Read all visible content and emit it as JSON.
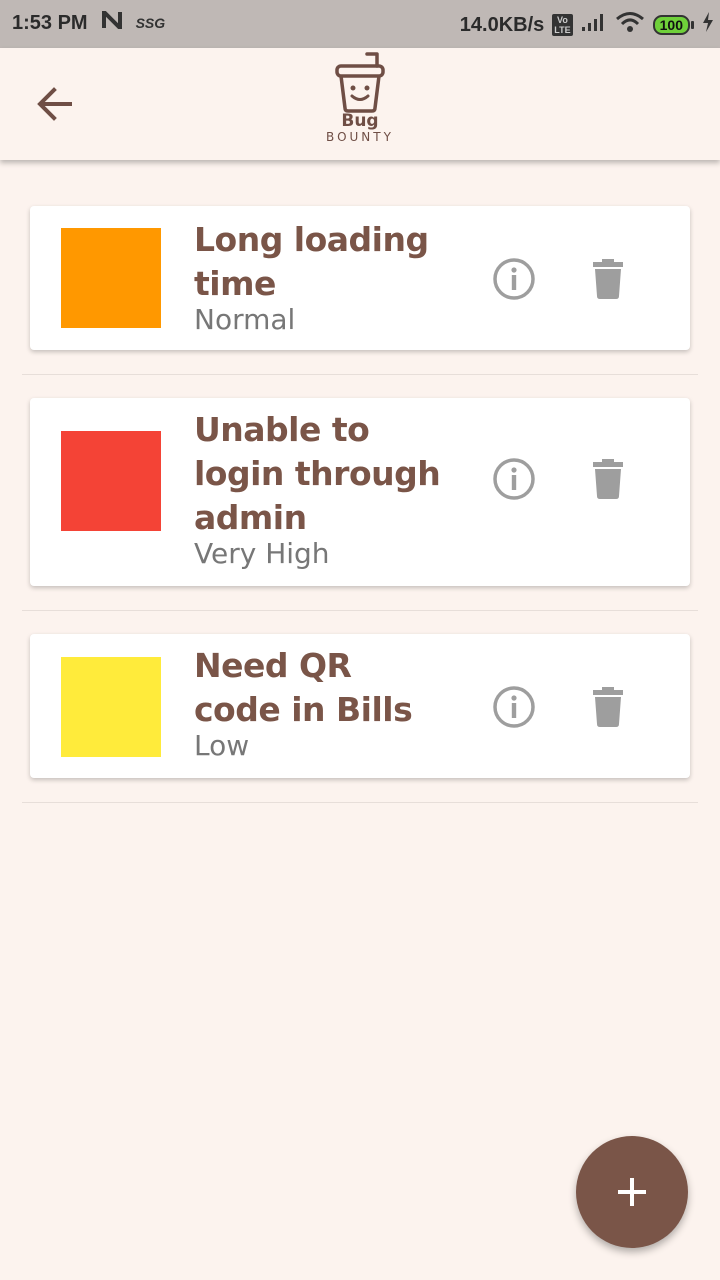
{
  "status_bar": {
    "time": "1:53 PM",
    "carrier_tag": "SSG",
    "net_speed": "14.0KB/s",
    "volte_top": "Vo",
    "volte_bottom": "LTE",
    "battery": "100"
  },
  "app_bar": {
    "logo_title": "Bug",
    "logo_subtitle": "BOUNTY",
    "back_icon": "arrow-left-icon"
  },
  "bugs": [
    {
      "title_line1": "Long loading",
      "title_line2": "time",
      "priority": "Normal",
      "color": "#ff9800"
    },
    {
      "title_line1": "Unable to",
      "title_line2": "login through",
      "title_line3": "admin",
      "priority": "Very High",
      "color": "#f44336"
    },
    {
      "title_line1": "Need QR",
      "title_line2": "code in Bills",
      "priority": "Low",
      "color": "#ffeb3b"
    }
  ],
  "icons": {
    "info": "info-icon",
    "delete": "delete-icon",
    "add": "plus-icon"
  },
  "colors": {
    "primary": "#7a5548",
    "background": "#fcf3ee",
    "icon_grey": "#9e9e9e"
  }
}
